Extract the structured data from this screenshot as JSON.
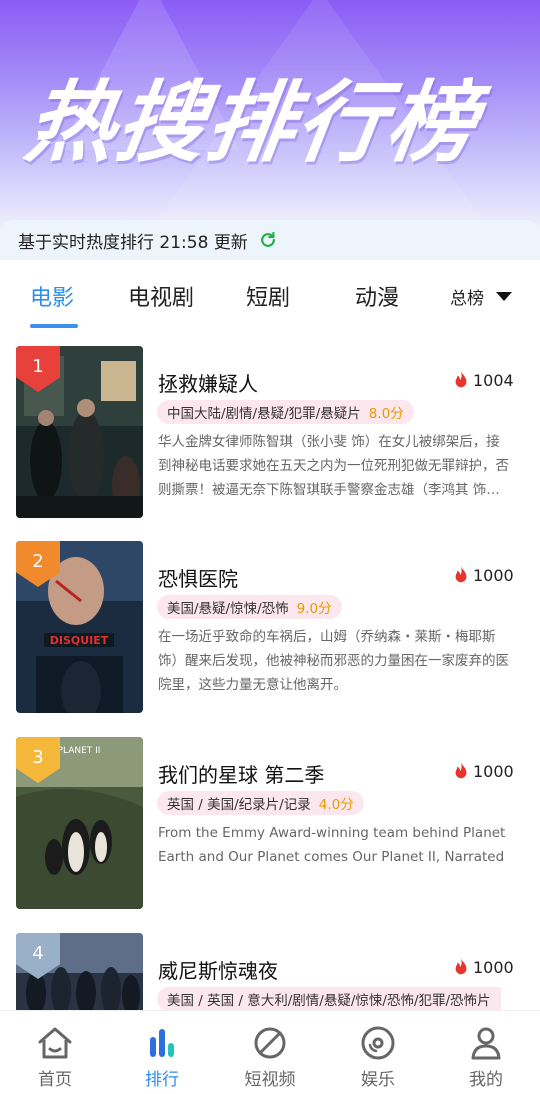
{
  "header": {
    "title": "热搜排行榜"
  },
  "update_bar": {
    "text": "基于实时热度排行 21:58 更新"
  },
  "tabs": [
    {
      "label": "电影",
      "active": true
    },
    {
      "label": "电视剧",
      "active": false
    },
    {
      "label": "短剧",
      "active": false
    },
    {
      "label": "动漫",
      "active": false
    }
  ],
  "tab_all": {
    "label": "总榜"
  },
  "items": [
    {
      "rank": "1",
      "title": "拯救嫌疑人",
      "heat": "1004",
      "tags": "中国大陆/剧情/悬疑/犯罪/悬疑片",
      "score": "8.0分",
      "desc": "华人金牌女律师陈智琪（张小斐 饰）在女儿被绑架后，接到神秘电话要求她在五天之内为一位死刑犯做无罪辩护，否则撕票！被逼无奈下陈智琪联手警察金志雄（李鸿其 饰…",
      "rank_color": "#e8413c"
    },
    {
      "rank": "2",
      "title": "恐惧医院",
      "heat": "1000",
      "tags": "美国/悬疑/惊悚/恐怖",
      "score": "9.0分",
      "desc": "在一场近乎致命的车祸后，山姆（乔纳森・莱斯・梅耶斯 饰）醒来后发现，他被神秘而邪恶的力量困在一家废弃的医院里，这些力量无意让他离开。",
      "rank_color": "#f08a2c"
    },
    {
      "rank": "3",
      "title": "我们的星球 第二季",
      "heat": "1000",
      "tags": "英国 / 美国/纪录片/记录",
      "score": "4.0分",
      "desc": "From the Emmy Award-winning team behind Planet Earth and Our Planet comes Our Planet II, Narrated by",
      "rank_color": "#f5b83a"
    },
    {
      "rank": "4",
      "title": "威尼斯惊魂夜",
      "heat": "1000",
      "tags": "美国 / 英国 / 意大利/剧情/悬疑/惊悚/恐怖/犯罪/恐怖片",
      "score": "",
      "desc": "",
      "rank_color": "#9ab0c8"
    }
  ],
  "nav": [
    {
      "label": "首页",
      "icon": "home-icon",
      "active": false
    },
    {
      "label": "排行",
      "icon": "ranking-icon",
      "active": true
    },
    {
      "label": "短视频",
      "icon": "short-video-icon",
      "active": false
    },
    {
      "label": "娱乐",
      "icon": "disc-icon",
      "active": false
    },
    {
      "label": "我的",
      "icon": "profile-icon",
      "active": false
    }
  ],
  "colors": {
    "accent": "#2e8ef0",
    "heat_fire": "#e8342c",
    "score": "#e89a00",
    "tag_bg": "#fde7ee"
  }
}
